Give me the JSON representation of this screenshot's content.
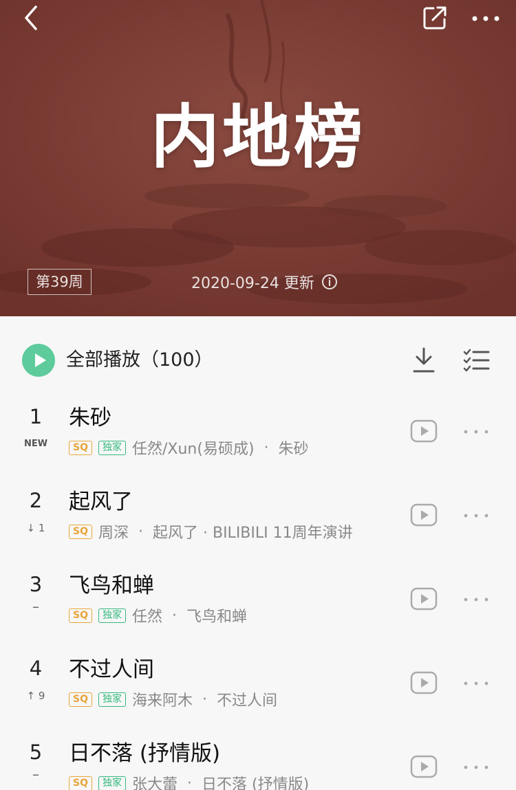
{
  "header": {
    "title": "内地榜",
    "week_badge": "第39周",
    "update_text": "2020-09-24 更新"
  },
  "colors": {
    "banner_bg": "#7a3a32",
    "accent_green": "#5dcb9b",
    "sq_tag": "#e8a53a",
    "exclusive_tag": "#34b97c"
  },
  "icons": {
    "back": "back-arrow-icon",
    "share": "share-icon",
    "more": "more-dots-icon",
    "info": "info-icon",
    "play_all": "play-circle-icon",
    "download": "download-icon",
    "multiselect": "multiselect-list-icon",
    "mv": "video-play-icon"
  },
  "play_all": {
    "label": "全部播放（100）"
  },
  "songs": [
    {
      "rank": "1",
      "change": "NEW",
      "title": "朱砂",
      "tag_sq": "SQ",
      "tag_exclusive": "独家",
      "artist": "任然/Xun(易硕成)",
      "separator": "·",
      "album": "朱砂"
    },
    {
      "rank": "2",
      "change": "↓ 1",
      "title": "起风了",
      "tag_sq": "SQ",
      "artist": "周深",
      "separator": "·",
      "album": "起风了 · BILIBILI 11周年演讲"
    },
    {
      "rank": "3",
      "change": "–",
      "title": "飞鸟和蝉",
      "tag_sq": "SQ",
      "tag_exclusive": "独家",
      "artist": "任然",
      "separator": "·",
      "album": "飞鸟和蝉"
    },
    {
      "rank": "4",
      "change": "↑ 9",
      "title": "不过人间",
      "tag_sq": "SQ",
      "tag_exclusive": "独家",
      "artist": "海来阿木",
      "separator": "·",
      "album": "不过人间"
    },
    {
      "rank": "5",
      "change": "–",
      "title": "日不落 (抒情版)",
      "tag_sq": "SQ",
      "tag_exclusive": "独家",
      "artist": "张大蕾",
      "separator": "·",
      "album": "日不落 (抒情版)"
    }
  ]
}
